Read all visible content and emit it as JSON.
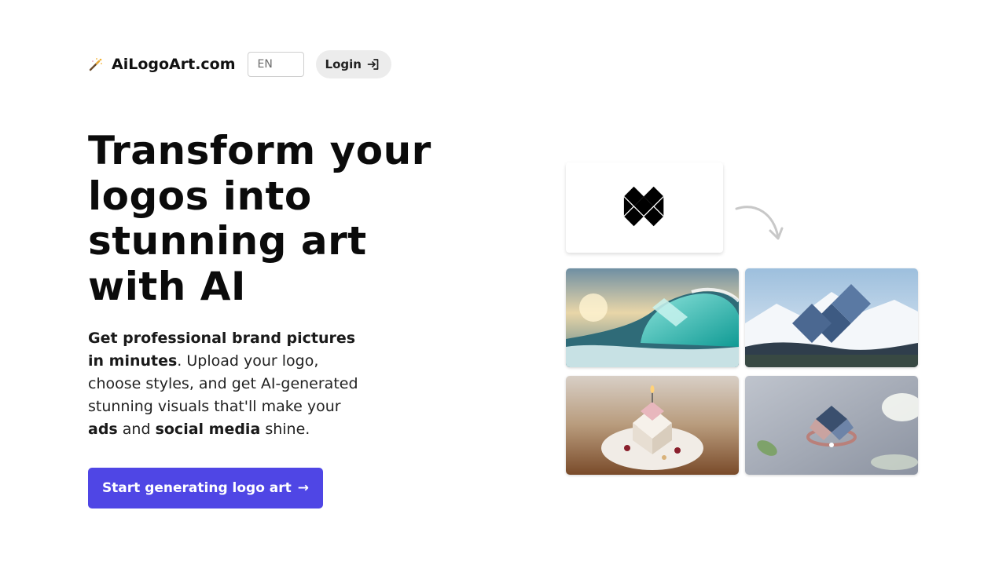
{
  "brand": {
    "name": "AiLogoArt.com",
    "icon": "magic-wand-icon"
  },
  "header": {
    "language": {
      "selected": "EN"
    },
    "login": {
      "label": "Login",
      "icon": "login-icon"
    }
  },
  "hero": {
    "headline": "Transform your logos into stunning art with AI",
    "subtext": {
      "bold_intro": "Get professional brand pictures in minutes",
      "part_1": ". Upload your logo, choose styles, and get AI-generated stunning visuals that'll make your ",
      "bold_ads": "ads",
      "part_2": " and ",
      "bold_social": "social media",
      "part_3": " shine."
    },
    "cta": {
      "label": "Start generating logo art",
      "icon": "arrow-right-icon"
    }
  },
  "showcase": {
    "source_logo": {
      "icon": "diamond-logo-icon"
    },
    "transform_arrow": {
      "icon": "curved-arrow-icon"
    },
    "images": [
      {
        "name": "wave-logo-art"
      },
      {
        "name": "mountain-logo-art"
      },
      {
        "name": "cake-logo-art"
      },
      {
        "name": "ring-logo-art"
      }
    ]
  },
  "colors": {
    "accent": "#4f46e5",
    "login_bg": "#ececec",
    "text": "#111111"
  }
}
